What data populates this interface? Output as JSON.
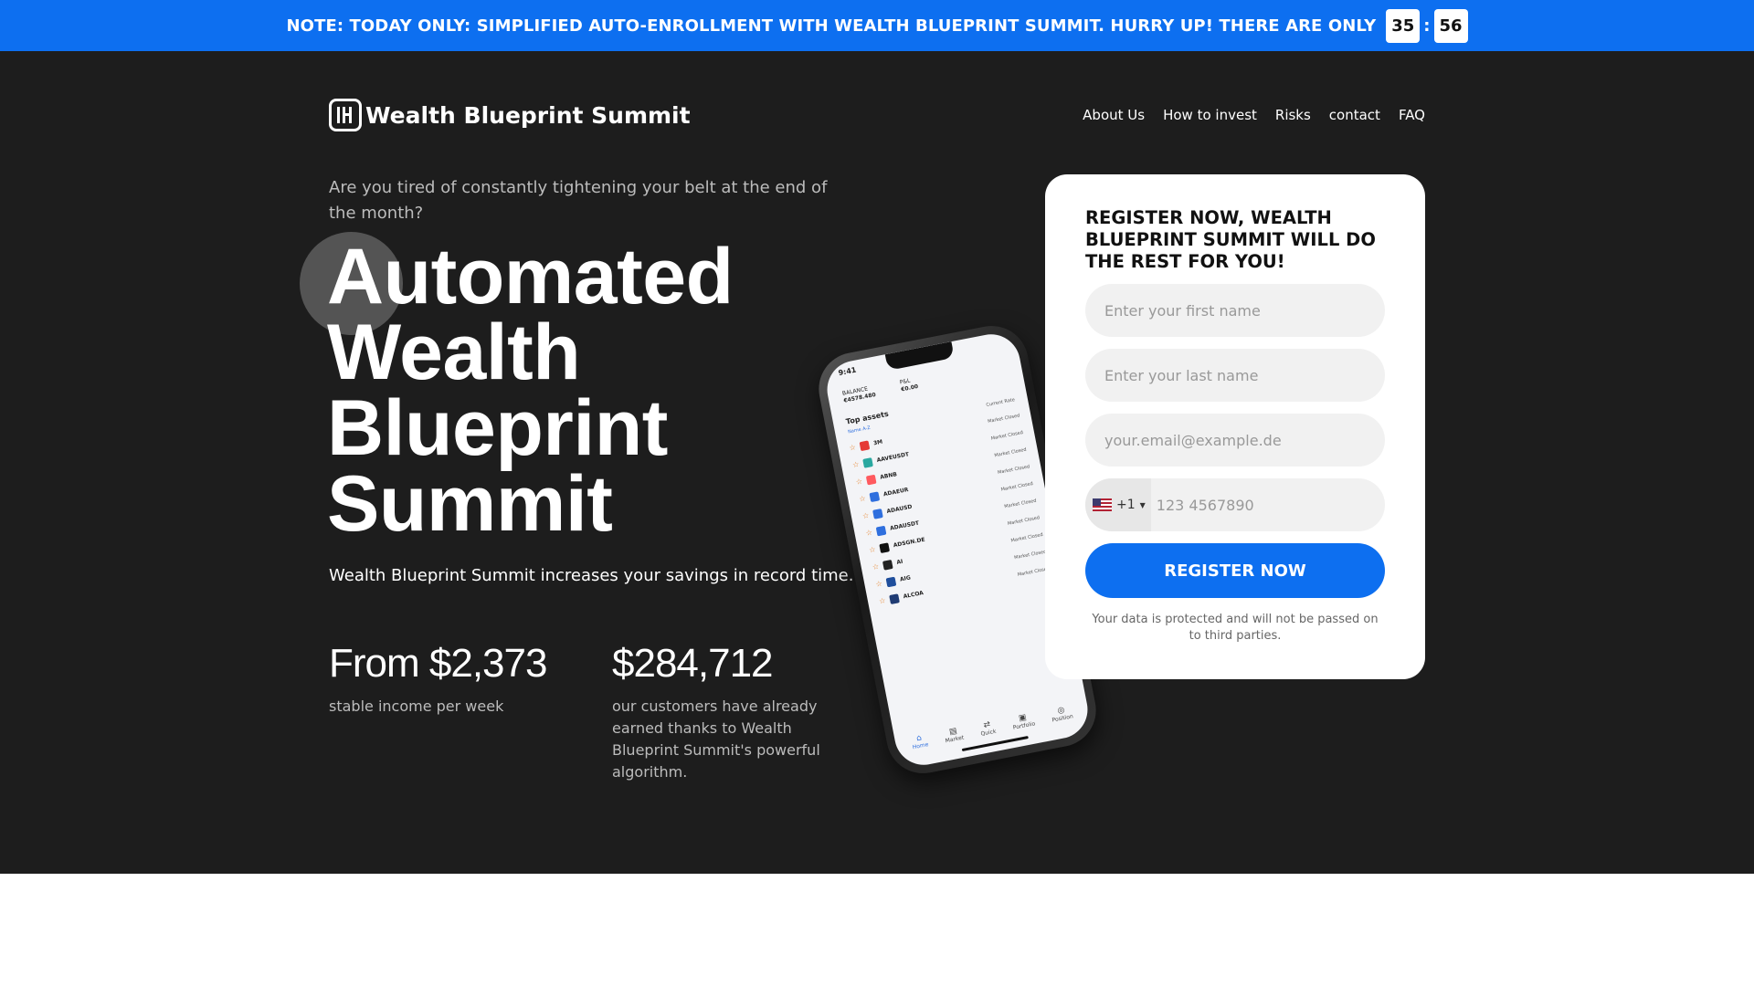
{
  "banner": {
    "text": "NOTE: TODAY ONLY: SIMPLIFIED AUTO-ENROLLMENT WITH WEALTH BLUEPRINT SUMMIT. HURRY UP! THERE ARE ONLY",
    "minutes": "35",
    "separator": ":",
    "seconds": "56",
    "color": "#0d6ff0"
  },
  "header": {
    "logo_text": "Wealth Blueprint Summit",
    "nav": [
      "About Us",
      "How to invest",
      "Risks",
      "contact",
      "FAQ"
    ]
  },
  "hero": {
    "question": "Are you tired of constantly tightening your belt at the end of the month?",
    "headline": [
      "Automated",
      "Wealth",
      "Blueprint",
      "Summit"
    ],
    "subheadline": "Wealth Blueprint Summit increases your savings in record time.",
    "stats": [
      {
        "value": "From $2,373",
        "desc": "stable income per week"
      },
      {
        "value": "$284,712",
        "desc": "our customers have already earned thanks to Wealth Blueprint Summit's powerful algorithm."
      }
    ],
    "background": "#1d1d1d"
  },
  "phone_mockup": {
    "time": "9:41",
    "balance_label": "BALANCE",
    "balance_value": "€4578.480",
    "pnl_label": "P&L",
    "pnl_value": "€0.00",
    "list_title": "Top assets",
    "sort_label": "Name A-Z",
    "column_label": "Current Rate",
    "assets": [
      {
        "name": "3M",
        "status": "Market Closed",
        "color": "#e53935"
      },
      {
        "name": "AAVEUSDT",
        "status": "Market Closed",
        "color": "#2aa8a0"
      },
      {
        "name": "ABNB",
        "status": "Market Closed",
        "color": "#ff5a5f"
      },
      {
        "name": "ADAEUR",
        "status": "Market Closed",
        "color": "#2f6fde"
      },
      {
        "name": "ADAUSD",
        "status": "Market Closed",
        "color": "#2f6fde"
      },
      {
        "name": "ADAUSDT",
        "status": "Market Closed",
        "color": "#2f6fde"
      },
      {
        "name": "ADSGN.DE",
        "status": "Market Closed",
        "color": "#111111"
      },
      {
        "name": "AI",
        "status": "Market Closed",
        "color": "#222222"
      },
      {
        "name": "AIG",
        "status": "Market Closed",
        "color": "#1f4e9c"
      },
      {
        "name": "ALCOA",
        "status": "Market Closed",
        "color": "#1f3b73"
      }
    ],
    "tabs": [
      {
        "label": "Home",
        "icon": "home-icon",
        "glyph": "⌂"
      },
      {
        "label": "Market",
        "icon": "market-icon",
        "glyph": "▤"
      },
      {
        "label": "Quick",
        "icon": "quick-icon",
        "glyph": "⇄"
      },
      {
        "label": "Portfolio",
        "icon": "portfolio-icon",
        "glyph": "▣"
      },
      {
        "label": "Position",
        "icon": "position-icon",
        "glyph": "◎"
      }
    ]
  },
  "form": {
    "title": "REGISTER NOW, WEALTH BLUEPRINT SUMMIT WILL DO THE REST FOR YOU!",
    "first_name_placeholder": "Enter your first name",
    "last_name_placeholder": "Enter your last name",
    "email_placeholder": "your.email@example.de",
    "country_code": "+1",
    "phone_placeholder": "123 4567890",
    "submit_label": "REGISTER NOW",
    "disclaimer": "Your data is protected and will not be passed on to third parties."
  }
}
